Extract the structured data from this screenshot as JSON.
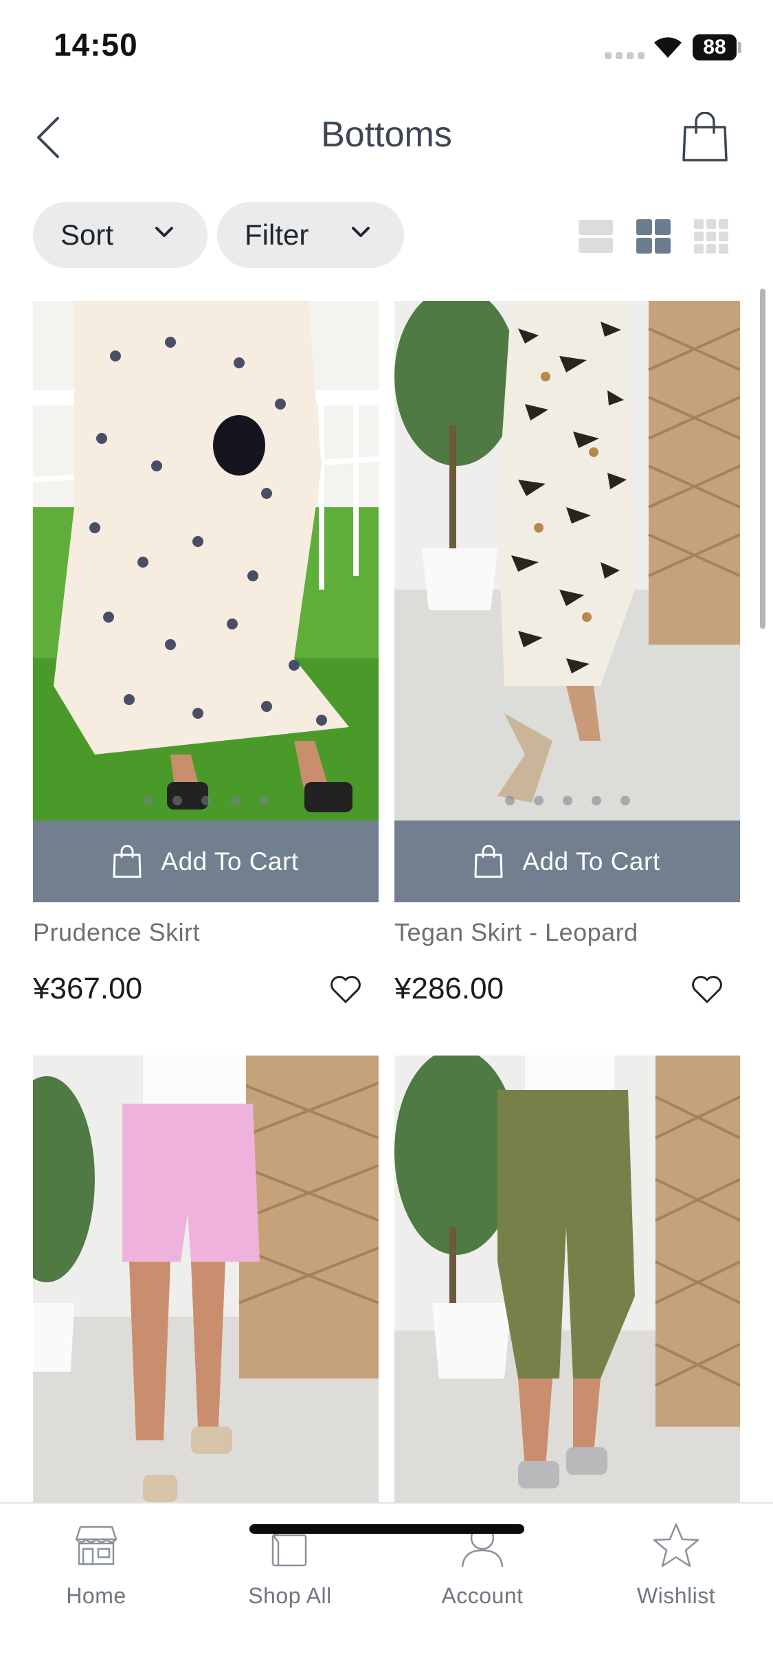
{
  "status_bar": {
    "time": "14:50",
    "battery": "88"
  },
  "header": {
    "title": "Bottoms"
  },
  "controls": {
    "sort_label": "Sort",
    "filter_label": "Filter",
    "selected_view": "grid-2"
  },
  "products": [
    {
      "name": "Prudence Skirt",
      "price": "¥367.00",
      "add_to_cart": "Add To Cart",
      "image": "white polka dot dress on grass"
    },
    {
      "name": "Tegan Skirt - Leopard",
      "price": "¥286.00",
      "add_to_cart": "Add To Cart",
      "image": "leopard print skirt"
    },
    {
      "name": "",
      "price": "",
      "image": "pink shorts"
    },
    {
      "name": "",
      "price": "",
      "image": "khaki green cropped joggers"
    }
  ],
  "tab_bar": {
    "items": [
      {
        "label": "Home",
        "icon": "store-icon"
      },
      {
        "label": "Shop All",
        "icon": "shopping-bag-icon"
      },
      {
        "label": "Account",
        "icon": "person-icon"
      },
      {
        "label": "Wishlist",
        "icon": "star-icon"
      }
    ]
  },
  "colors": {
    "accent": "#717f8f",
    "pill_bg": "#ebebeb",
    "text_primary": "#2f3a44",
    "icon_active": "#6c7d90"
  }
}
